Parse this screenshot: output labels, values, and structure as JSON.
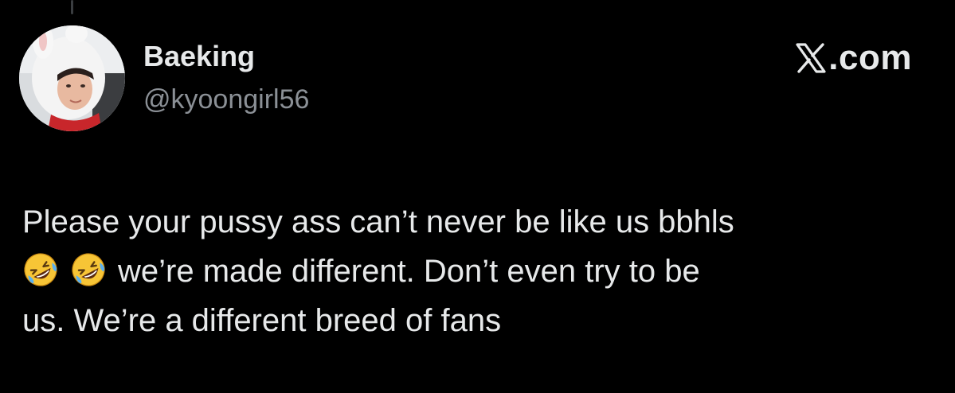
{
  "author": {
    "display_name": "Baeking",
    "handle": "@kyoongirl56"
  },
  "brand": {
    "domain": ".com",
    "logo_icon": "x-logo-icon"
  },
  "tweet": {
    "line1": "Please your pussy ass can’t never be like us bbhls",
    "line2_after_emoji": "we’re made different. Don’t even try to be",
    "line3": "us. We’re a different breed of fans",
    "emoji_icon": "rolling-on-floor-laughing-emoji-icon",
    "emoji_count": 2
  },
  "colors": {
    "background": "#000000",
    "primary_text": "#e7e9ea",
    "secondary_text": "#8b9096"
  }
}
